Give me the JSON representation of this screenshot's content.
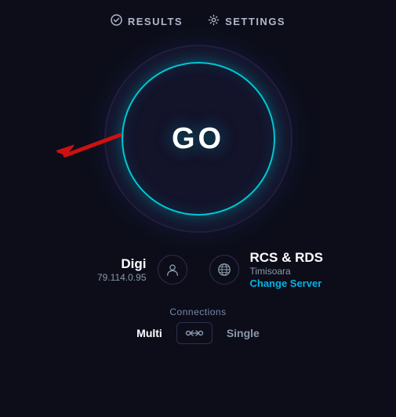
{
  "nav": {
    "results_label": "RESULTS",
    "settings_label": "SETTINGS"
  },
  "go_button": {
    "label": "GO"
  },
  "info": {
    "isp_name": "Digi",
    "ip_address": "79.114.0.95",
    "server_name": "RCS & RDS",
    "server_city": "Timisoara",
    "change_server_label": "Change Server"
  },
  "connections": {
    "label": "Connections",
    "multi_label": "Multi",
    "single_label": "Single"
  },
  "colors": {
    "accent_cyan": "#00c8d4",
    "accent_blue": "#00b4e6",
    "bg_dark": "#0d0d1a"
  }
}
